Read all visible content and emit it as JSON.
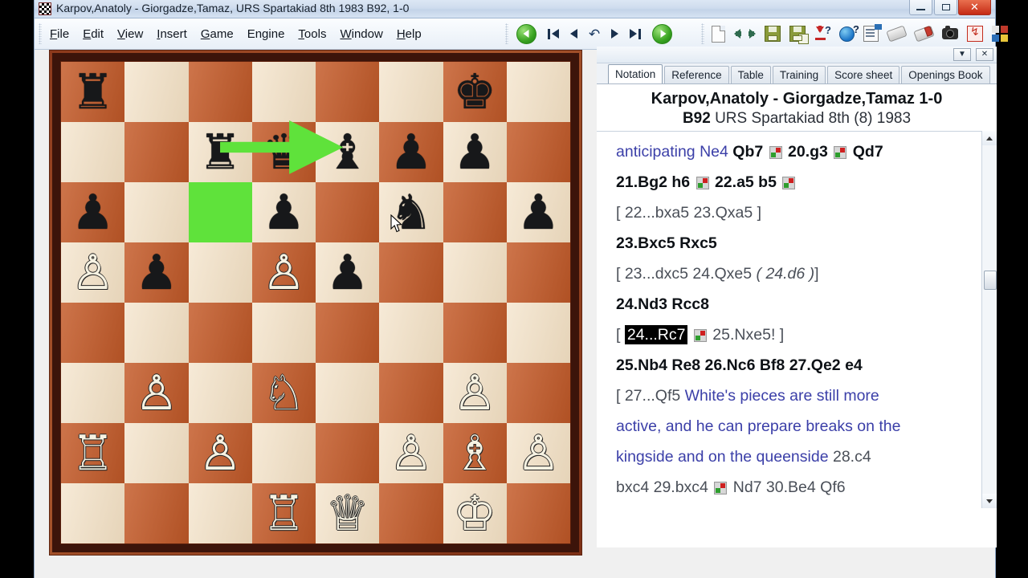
{
  "window": {
    "title": "Karpov,Anatoly - Giorgadze,Tamaz, URS Spartakiad 8th 1983  B92, 1-0",
    "icon": "chessboard-icon",
    "minimize_label": "",
    "maximize_label": "",
    "close_label": "✕"
  },
  "menu": {
    "items": [
      {
        "pre": "",
        "key": "F",
        "post": "ile"
      },
      {
        "pre": "",
        "key": "E",
        "post": "dit"
      },
      {
        "pre": "",
        "key": "V",
        "post": "iew"
      },
      {
        "pre": "",
        "key": "I",
        "post": "nsert"
      },
      {
        "pre": "",
        "key": "G",
        "post": "ame"
      },
      {
        "pre": "En",
        "key": "g",
        "post": "ine"
      },
      {
        "pre": "",
        "key": "T",
        "post": "ools"
      },
      {
        "pre": "",
        "key": "W",
        "post": "indow"
      },
      {
        "pre": "",
        "key": "H",
        "post": "elp"
      }
    ]
  },
  "toolbar": {
    "nav": [
      {
        "name": "back-green-button",
        "icon": "circle-arrow-left-icon"
      },
      {
        "name": "first-move-button",
        "icon": "skip-to-start-icon"
      },
      {
        "name": "previous-move-button",
        "icon": "triangle-left-icon"
      },
      {
        "name": "undo-button",
        "icon": "undo-arrow-icon"
      },
      {
        "name": "next-move-button",
        "icon": "triangle-right-icon"
      },
      {
        "name": "last-move-button",
        "icon": "skip-to-end-icon"
      },
      {
        "name": "forward-green-button",
        "icon": "circle-arrow-right-icon"
      }
    ],
    "file": [
      {
        "name": "new-game-button",
        "icon": "document-icon"
      },
      {
        "name": "previous-game-button",
        "icon": "green-arrow-left-icon"
      },
      {
        "name": "next-game-button",
        "icon": "green-arrow-right-icon"
      },
      {
        "name": "save-game-button",
        "icon": "floppy-disk-icon"
      },
      {
        "name": "save-as-button",
        "icon": "floppy-disk-plus-icon"
      },
      {
        "name": "download-help-button",
        "icon": "down-arrow-question-icon"
      },
      {
        "name": "online-help-button",
        "icon": "globe-question-icon"
      },
      {
        "name": "game-data-button",
        "icon": "sheet-flag-icon"
      },
      {
        "name": "erase-button",
        "icon": "eraser-icon"
      },
      {
        "name": "erase-red-button",
        "icon": "eraser-red-icon"
      },
      {
        "name": "screenshot-button",
        "icon": "camera-icon"
      },
      {
        "name": "analysis-button",
        "icon": "red-lightning-box-icon"
      },
      {
        "name": "layout-button",
        "icon": "four-quadrant-icon"
      }
    ]
  },
  "panel": {
    "header": {
      "dropdown": "▼",
      "close": "✕"
    },
    "tabs": [
      {
        "label": "Notation",
        "active": true
      },
      {
        "label": "Reference",
        "active": false
      },
      {
        "label": "Table",
        "active": false
      },
      {
        "label": "Training",
        "active": false
      },
      {
        "label": "Score sheet",
        "active": false
      },
      {
        "label": "Openings Book",
        "active": false
      }
    ],
    "game_header": {
      "players": "Karpov,Anatoly - Giorgadze,Tamaz  1-0",
      "eco": "B92",
      "event": "URS Spartakiad 8th (8) 1983"
    },
    "scrollbar": {
      "up": "▲",
      "down": "▼"
    }
  },
  "notation": {
    "lines": [
      [
        {
          "t": "anticipating ",
          "s": "cmt"
        },
        {
          "t": "Ne4 ",
          "s": "cmt"
        },
        {
          "t": "Qb7 ",
          "s": "mv"
        },
        {
          "t": "",
          "s": "nag"
        },
        {
          "t": " 20.g3 ",
          "s": "mv"
        },
        {
          "t": "",
          "s": "nag"
        },
        {
          "t": " Qd7",
          "s": "mv"
        }
      ],
      [
        {
          "t": "21.Bg2  h6 ",
          "s": "mv"
        },
        {
          "t": "",
          "s": "nag"
        },
        {
          "t": "  22.a5  b5 ",
          "s": "mv"
        },
        {
          "t": "",
          "s": "nag"
        }
      ],
      [
        {
          "t": "  [ 22...bxa5  23.Qxa5 ]",
          "s": "var"
        }
      ],
      [
        {
          "t": "23.Bxc5  Rxc5",
          "s": "mv"
        }
      ],
      [
        {
          "t": "  [ 23...dxc5  24.Qxe5 ",
          "s": "var"
        },
        {
          "t": "( 24.d6 )",
          "s": "vari"
        },
        {
          "t": "]",
          "s": "var"
        }
      ],
      [
        {
          "t": "24.Nd3  Rcc8",
          "s": "mv"
        }
      ],
      [
        {
          "t": "  [ ",
          "s": "var"
        },
        {
          "t": "24...Rc7",
          "s": "hl"
        },
        {
          "t": " ",
          "s": "var"
        },
        {
          "t": "",
          "s": "nag"
        },
        {
          "t": "  25.Nxe5! ]",
          "s": "var"
        }
      ],
      [
        {
          "t": "25.Nb4  Re8  26.Nc6  Bf8  27.Qe2  e4",
          "s": "mv"
        }
      ],
      [
        {
          "t": "  [ 27...Qf5 ",
          "s": "var"
        },
        {
          "t": "White's pieces are still  more",
          "s": "cmt"
        }
      ],
      [
        {
          "t": "  active, and he can prepare breaks on the",
          "s": "cmt"
        }
      ],
      [
        {
          "t": "  kingside and on the queenside ",
          "s": "cmt"
        },
        {
          "t": "28.c4",
          "s": "var"
        }
      ],
      [
        {
          "t": "bxc4  29.bxc4 ",
          "s": "var"
        },
        {
          "t": "",
          "s": "nag"
        },
        {
          "t": " Nd7  30.Be4  Qf6",
          "s": "var"
        }
      ]
    ]
  },
  "board": {
    "colors": {
      "light": "#f2dfc2",
      "dark": "#c45a28",
      "highlight": "#5fe23b",
      "frame": "#8c3a1c"
    },
    "highlight_squares": [
      "c6"
    ],
    "arrow": {
      "from": "c7",
      "to": "e7",
      "color": "#5fe23b"
    },
    "cursor_square": "e7",
    "pieces": [
      {
        "sq": "a8",
        "p": "♜",
        "c": "b"
      },
      {
        "sq": "g8",
        "p": "♚",
        "c": "b"
      },
      {
        "sq": "c7",
        "p": "♜",
        "c": "b"
      },
      {
        "sq": "d7",
        "p": "♛",
        "c": "b"
      },
      {
        "sq": "e7",
        "p": "♝",
        "c": "b"
      },
      {
        "sq": "f7",
        "p": "♟",
        "c": "b"
      },
      {
        "sq": "g7",
        "p": "♟",
        "c": "b"
      },
      {
        "sq": "a6",
        "p": "♟",
        "c": "b"
      },
      {
        "sq": "d6",
        "p": "♟",
        "c": "b"
      },
      {
        "sq": "f6",
        "p": "♞",
        "c": "b"
      },
      {
        "sq": "h6",
        "p": "♟",
        "c": "b"
      },
      {
        "sq": "a5",
        "p": "♙",
        "c": "w"
      },
      {
        "sq": "b5",
        "p": "♟",
        "c": "b"
      },
      {
        "sq": "d5",
        "p": "♙",
        "c": "w"
      },
      {
        "sq": "e5",
        "p": "♟",
        "c": "b"
      },
      {
        "sq": "b3",
        "p": "♙",
        "c": "w"
      },
      {
        "sq": "d3",
        "p": "♘",
        "c": "w"
      },
      {
        "sq": "g3",
        "p": "♙",
        "c": "w"
      },
      {
        "sq": "a2",
        "p": "♖",
        "c": "w"
      },
      {
        "sq": "c2",
        "p": "♙",
        "c": "w"
      },
      {
        "sq": "f2",
        "p": "♙",
        "c": "w"
      },
      {
        "sq": "g2",
        "p": "♗",
        "c": "w"
      },
      {
        "sq": "h2",
        "p": "♙",
        "c": "w"
      },
      {
        "sq": "d1",
        "p": "♖",
        "c": "w"
      },
      {
        "sq": "e1",
        "p": "♕",
        "c": "w"
      },
      {
        "sq": "g1",
        "p": "♔",
        "c": "w"
      }
    ]
  }
}
